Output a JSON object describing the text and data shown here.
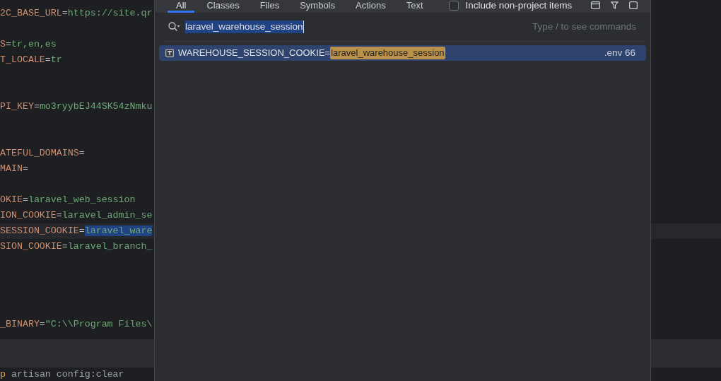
{
  "editor": {
    "code_blocks": [
      [
        {
          "key": "2C_BASE_URL",
          "operator": "=",
          "value": "https://site.qr",
          "current": false,
          "value_selected": false
        }
      ],
      [
        {
          "key": "S",
          "operator": "=",
          "value": "tr,en,es",
          "current": false,
          "value_selected": false
        },
        {
          "key": "T_LOCALE",
          "operator": "=",
          "value": "tr",
          "current": false,
          "value_selected": false
        }
      ],
      [
        {
          "key": "PI_KEY",
          "operator": "=",
          "value": "mo3ryybEJ44SK54zNmku",
          "current": false,
          "value_selected": false
        }
      ],
      [
        {
          "key": "ATEFUL_DOMAINS",
          "operator": "=",
          "current": false
        },
        {
          "key": "MAIN",
          "operator": "=",
          "current": false
        }
      ],
      [
        {
          "key": "OKIE",
          "operator": "=",
          "value": "laravel_web_session",
          "current": false,
          "value_selected": false
        },
        {
          "key": "ION_COOKIE",
          "operator": "=",
          "value": "laravel_admin_se",
          "current": false,
          "value_selected": false
        },
        {
          "key": "SESSION_COOKIE",
          "operator": "=",
          "value": "laravel_ware",
          "current": true,
          "value_selected": true
        },
        {
          "key": "SION_COOKIE",
          "operator": "=",
          "value": "laravel_branch_",
          "current": false,
          "value_selected": false
        }
      ],
      [
        {
          "key": "_BINARY",
          "operator": "=",
          "value": "\"C:\\\\Program Files\\",
          "current": false,
          "value_selected": false
        }
      ]
    ],
    "terminal_line": {
      "command": "p",
      "arguments": "artisan config:clear"
    }
  },
  "search_popup": {
    "tabs": [
      {
        "label": "All",
        "selected": true
      },
      {
        "label": "Classes",
        "selected": false
      },
      {
        "label": "Files",
        "selected": false
      },
      {
        "label": "Symbols",
        "selected": false
      },
      {
        "label": "Actions",
        "selected": false
      },
      {
        "label": "Text",
        "selected": false
      }
    ],
    "include_option": {
      "label": "Include non-project items",
      "checked": false
    },
    "search": {
      "value": "laravel_warehouse_session",
      "value_selected": true,
      "hint": "Type / to see commands"
    },
    "results": [
      {
        "prefix": "WAREHOUSE_SESSION_COOKIE=",
        "match": "laravel_warehouse_session",
        "location": ".env 66",
        "selected": true
      }
    ]
  }
}
